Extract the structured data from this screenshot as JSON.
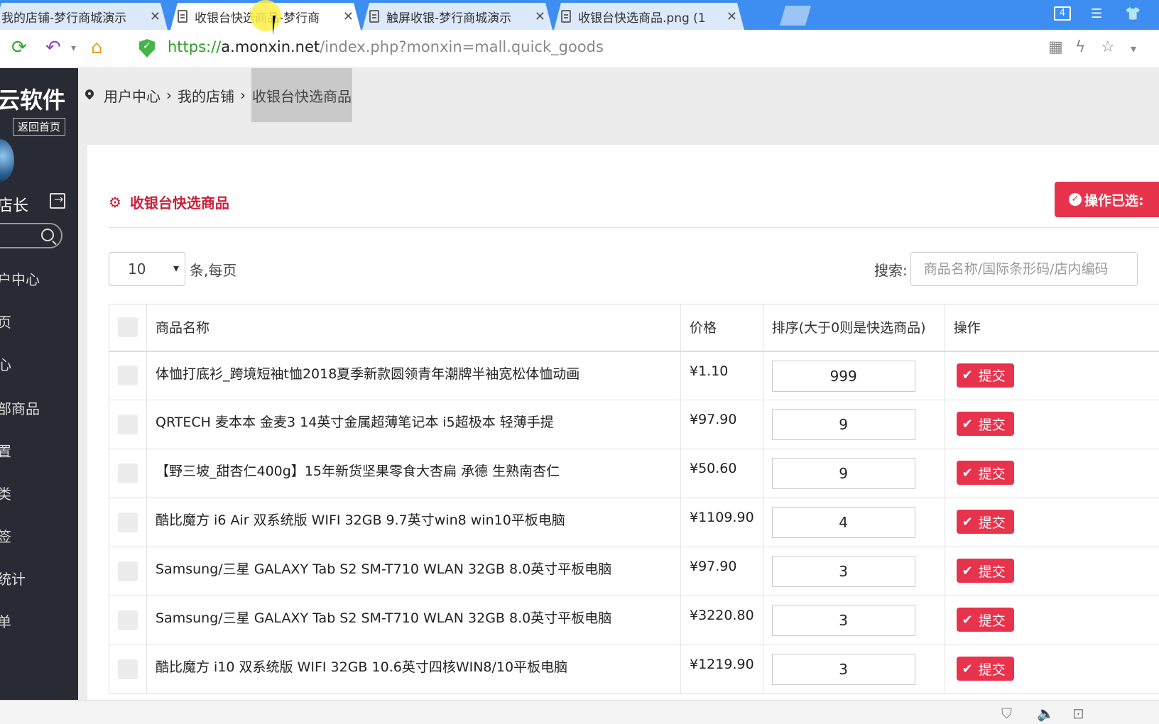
{
  "browser": {
    "tabs": [
      {
        "title": "我的店铺-梦行商城演示"
      },
      {
        "title": "收银台快选商品-梦行商"
      },
      {
        "title": "触屏收银-梦行商城演示"
      },
      {
        "title": "收银台快选商品.png (1"
      }
    ],
    "window_count": "4",
    "url": {
      "scheme": "https://",
      "host": "a.monxin.net",
      "path": "/index.php?monxin=mall.quick_goods"
    }
  },
  "sidebar": {
    "logo": "云软件",
    "home_link": "返回首页",
    "user": "店长",
    "items": [
      "户中心",
      "页",
      "心",
      "部商品",
      "置",
      "类",
      "签",
      "统计",
      "单"
    ]
  },
  "breadcrumb": [
    "用户中心",
    "我的店铺",
    "收银台快选商品"
  ],
  "panel": {
    "title": "收银台快选商品",
    "ops_button": "操作已选:",
    "per_page_value": "10",
    "per_page_label": "条,每页",
    "search_label": "搜索:",
    "search_placeholder": "商品名称/国际条形码/店内编码"
  },
  "table": {
    "headers": {
      "name": "商品名称",
      "price": "价格",
      "sort": "排序(大于0则是快选商品)",
      "action": "操作"
    },
    "submit_label": "提交",
    "rows": [
      {
        "name": "体恤打底衫_跨境短袖t恤2018夏季新款圆领青年潮牌半袖宽松体恤动画",
        "price": "¥1.10",
        "sort": "999"
      },
      {
        "name": "QRTECH 麦本本 金麦3 14英寸金属超薄笔记本 i5超极本 轻薄手提",
        "price": "¥97.90",
        "sort": "9"
      },
      {
        "name": "【野三坡_甜杏仁400g】15年新货坚果零食大杏扁 承德 生熟南杏仁",
        "price": "¥50.60",
        "sort": "9"
      },
      {
        "name": "酷比魔方 i6 Air 双系统版 WIFI 32GB 9.7英寸win8 win10平板电脑",
        "price": "¥1109.90",
        "sort": "4"
      },
      {
        "name": "Samsung/三星 GALAXY Tab S2 SM-T710 WLAN 32GB 8.0英寸平板电脑",
        "price": "¥97.90",
        "sort": "3"
      },
      {
        "name": "Samsung/三星 GALAXY Tab S2 SM-T710 WLAN 32GB 8.0英寸平板电脑",
        "price": "¥3220.80",
        "sort": "3"
      },
      {
        "name": "酷比魔方 i10 双系统版 WIFI 32GB 10.6英寸四核WIN8/10平板电脑",
        "price": "¥1219.90",
        "sort": "3"
      }
    ]
  },
  "colors": {
    "accent": "#e8334d",
    "title_red": "#c9213b",
    "tabbar": "#3d8ef0",
    "sidebar": "#282b33"
  }
}
